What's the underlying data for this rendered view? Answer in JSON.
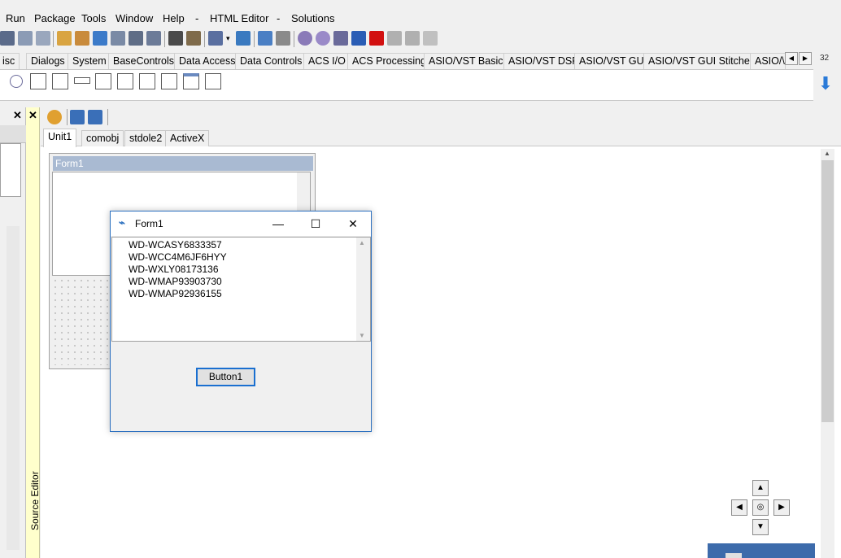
{
  "menu": [
    "Run",
    "Package",
    "Tools",
    "Window",
    "Help",
    "HTML Editor",
    "-",
    "Solutions"
  ],
  "menu_separator_before_html": "-",
  "palette_tabs": [
    "isc",
    "Dialogs",
    "System",
    "BaseControls",
    "Data Access",
    "Data Controls",
    "ACS I/O",
    "ACS Processing",
    "ASIO/VST Basics",
    "ASIO/VST DSP",
    "ASIO/VST GUI",
    "ASIO/VST GUI Stitched",
    "ASIO/\\"
  ],
  "right_badge": "32",
  "source_editor_label": "Source Editor",
  "editor_tabs": [
    "Unit1",
    "comobj",
    "stdole2",
    "ActiveX"
  ],
  "design_form_title": "Form1",
  "form1": {
    "title": "Form1",
    "minimize": "—",
    "maximize": "☐",
    "close": "✕",
    "memo_lines": [
      "WD-WCASY6833357",
      "WD-WCC4M6JF6HYY",
      "WD-WXLY08173136",
      "WD-WMAP93903730",
      "WD-WMAP92936155"
    ],
    "button": "Button1"
  },
  "nav_center": "◎"
}
